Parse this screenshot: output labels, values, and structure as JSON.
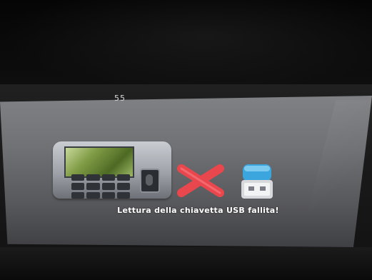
{
  "screen": {
    "top_digits": "55",
    "error_message": "Lettura della chiavetta USB fallita!"
  },
  "icons": {
    "device": "fingerprint-terminal-icon",
    "status": "error-x-icon",
    "media": "usb-stick-icon"
  },
  "colors": {
    "error_x": "#e8474d",
    "usb_cap": "#3aa6dd",
    "screen_bg": "#6f7174"
  }
}
